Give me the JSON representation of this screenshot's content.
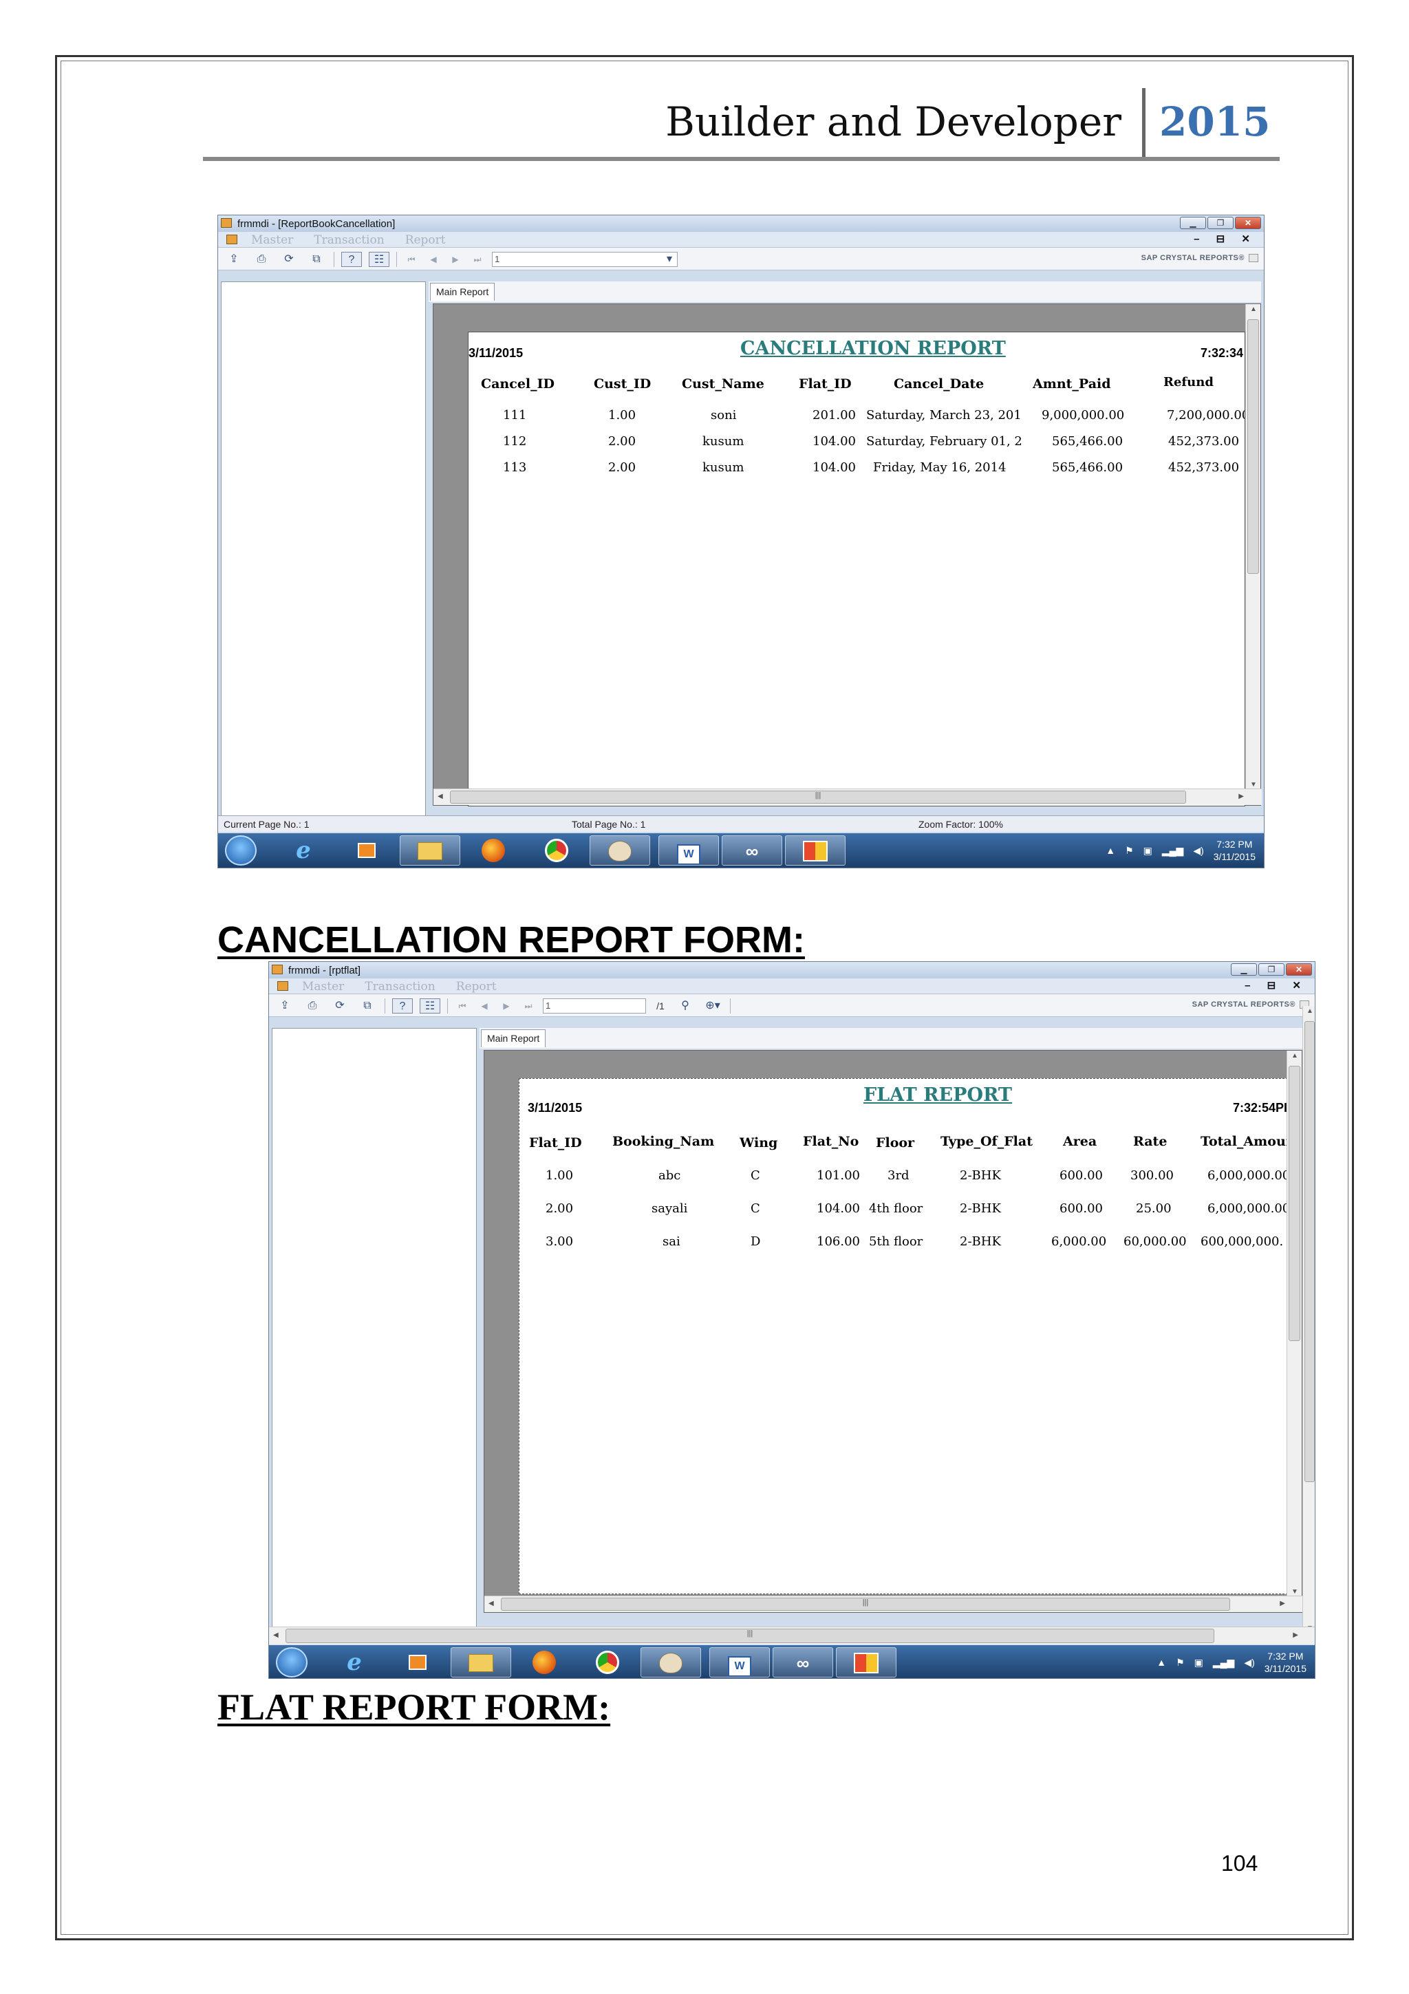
{
  "header": {
    "title": "Builder and Developer",
    "year": "2015"
  },
  "screenshot1": {
    "window_title": "frmmdi - [ReportBookCancellation]",
    "menu": [
      "Master",
      "Transaction",
      "Report"
    ],
    "mdi_controls": "– ⊟ ✕",
    "page_field": "1",
    "brand": "SAP CRYSTAL REPORTS®",
    "tab": "Main Report",
    "report": {
      "title": "CANCELLATION REPORT",
      "date": "3/11/2015",
      "time": "7:32:34",
      "columns": [
        "Cancel_ID",
        "Cust_ID",
        "Cust_Name",
        "Flat_ID",
        "Cancel_Date",
        "Amnt_Paid",
        "Refund"
      ],
      "rows": [
        [
          "111",
          "1.00",
          "soni",
          "201.00",
          "Saturday, March 23, 201",
          "9,000,000.00",
          "7,200,000.00"
        ],
        [
          "112",
          "2.00",
          "kusum",
          "104.00",
          "Saturday, February 01, 2",
          "565,466.00",
          "452,373.00"
        ],
        [
          "113",
          "2.00",
          "kusum",
          "104.00",
          "Friday, May 16, 2014",
          "565,466.00",
          "452,373.00"
        ]
      ]
    },
    "status": {
      "current_page": "Current Page No.: 1",
      "total_page": "Total Page No.: 1",
      "zoom": "Zoom Factor: 100%"
    },
    "clock": {
      "time": "7:32 PM",
      "date": "3/11/2015"
    }
  },
  "caption1": "CANCELLATION REPORT FORM:",
  "screenshot2": {
    "window_title": "frmmdi - [rptflat]",
    "menu": [
      "Master",
      "Transaction",
      "Report"
    ],
    "mdi_controls": "– ⊟ ✕",
    "page_field": "1",
    "page_total": "/1",
    "brand": "SAP CRYSTAL REPORTS®",
    "tab": "Main Report",
    "report": {
      "title": "FLAT REPORT",
      "date": "3/11/2015",
      "time": "7:32:54PI",
      "columns": [
        "Flat_ID",
        "Booking_Nam",
        "Wing",
        "Flat_No",
        "Floor",
        "Type_Of_Flat",
        "Area",
        "Rate",
        "Total_Amount"
      ],
      "rows": [
        [
          "1.00",
          "abc",
          "C",
          "101.00",
          "3rd",
          "2-BHK",
          "600.00",
          "300.00",
          "6,000,000.00"
        ],
        [
          "2.00",
          "sayali",
          "C",
          "104.00",
          "4th floor",
          "2-BHK",
          "600.00",
          "25.00",
          "6,000,000.00"
        ],
        [
          "3.00",
          "sai",
          "D",
          "106.00",
          "5th floor",
          "2-BHK",
          "6,000.00",
          "60,000.00",
          "600,000,000."
        ]
      ]
    },
    "clock": {
      "time": "7:32 PM",
      "date": "3/11/2015"
    }
  },
  "caption2": "FLAT REPORT FORM:",
  "page_number": "104"
}
